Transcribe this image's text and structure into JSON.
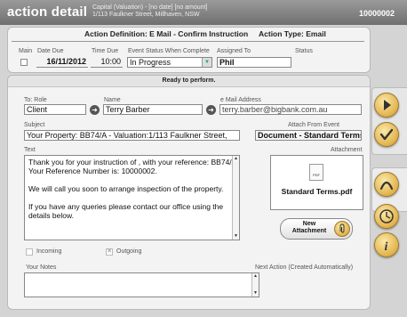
{
  "header": {
    "title": "action detail",
    "subtitle_line1": "Capital (Valuation) -  [no date] [no amount]",
    "subtitle_line2": "1/113 Faulkner Street, Millhaven, NSW",
    "number": "10000002"
  },
  "top": {
    "action_definition": "Action Definition: E Mail - Confirm Instruction",
    "action_type": "Action Type: Email",
    "col_main": "Main",
    "col_date_due": "Date Due",
    "col_time_due": "Time Due",
    "col_event_status": "Event Status When Complete",
    "col_assigned_to": "Assigned To",
    "col_status": "Status",
    "date_due": "16/11/2012",
    "time_due": "10:00",
    "event_status": "In Progress",
    "assigned_to": "Phil"
  },
  "detail": {
    "banner": "Ready to perform.",
    "to_role_label": "To: Role",
    "to_role": "Client",
    "name_label": "Name",
    "name": "Terry Barber",
    "email_label": "e Mail Address",
    "email": "terry.barber@bigbank.com.au",
    "subject_label": "Subject",
    "subject": "Your Property: BB74/A - Valuation:1/113 Faulkner Street,",
    "attach_from_event_label": "Attach From Event",
    "attach_from_event": "Document - Standard Terms.",
    "text_label": "Text",
    "text_lines": [
      "Thank you for your instruction of , with your reference: BB74/A.",
      "Your Reference Number is: 10000002.",
      "",
      "We will call you soon to arrange inspection of the property.",
      "",
      "If you have any queries please contact our office using the",
      "details below."
    ],
    "attachment_label": "Attachment",
    "attachment_file": "Standard Terms.pdf",
    "attachment_icon_text": "PDF",
    "new_attachment_line1": "New",
    "new_attachment_line2": "Attachment",
    "incoming_label": "Incoming",
    "outgoing_label": "Outgoing",
    "your_notes_label": "Your Notes",
    "next_action_label": "Next Action (Created Automatically)"
  },
  "colors": {
    "accent_gold": "#e2b24a",
    "header_gray": "#7d7d7d"
  },
  "icons": [
    "arrow-right-icon",
    "checkmark-icon",
    "arch-icon",
    "clock-icon",
    "info-icon",
    "paperclip-icon",
    "pdf-file-icon",
    "dropdown-arrow-icon"
  ]
}
